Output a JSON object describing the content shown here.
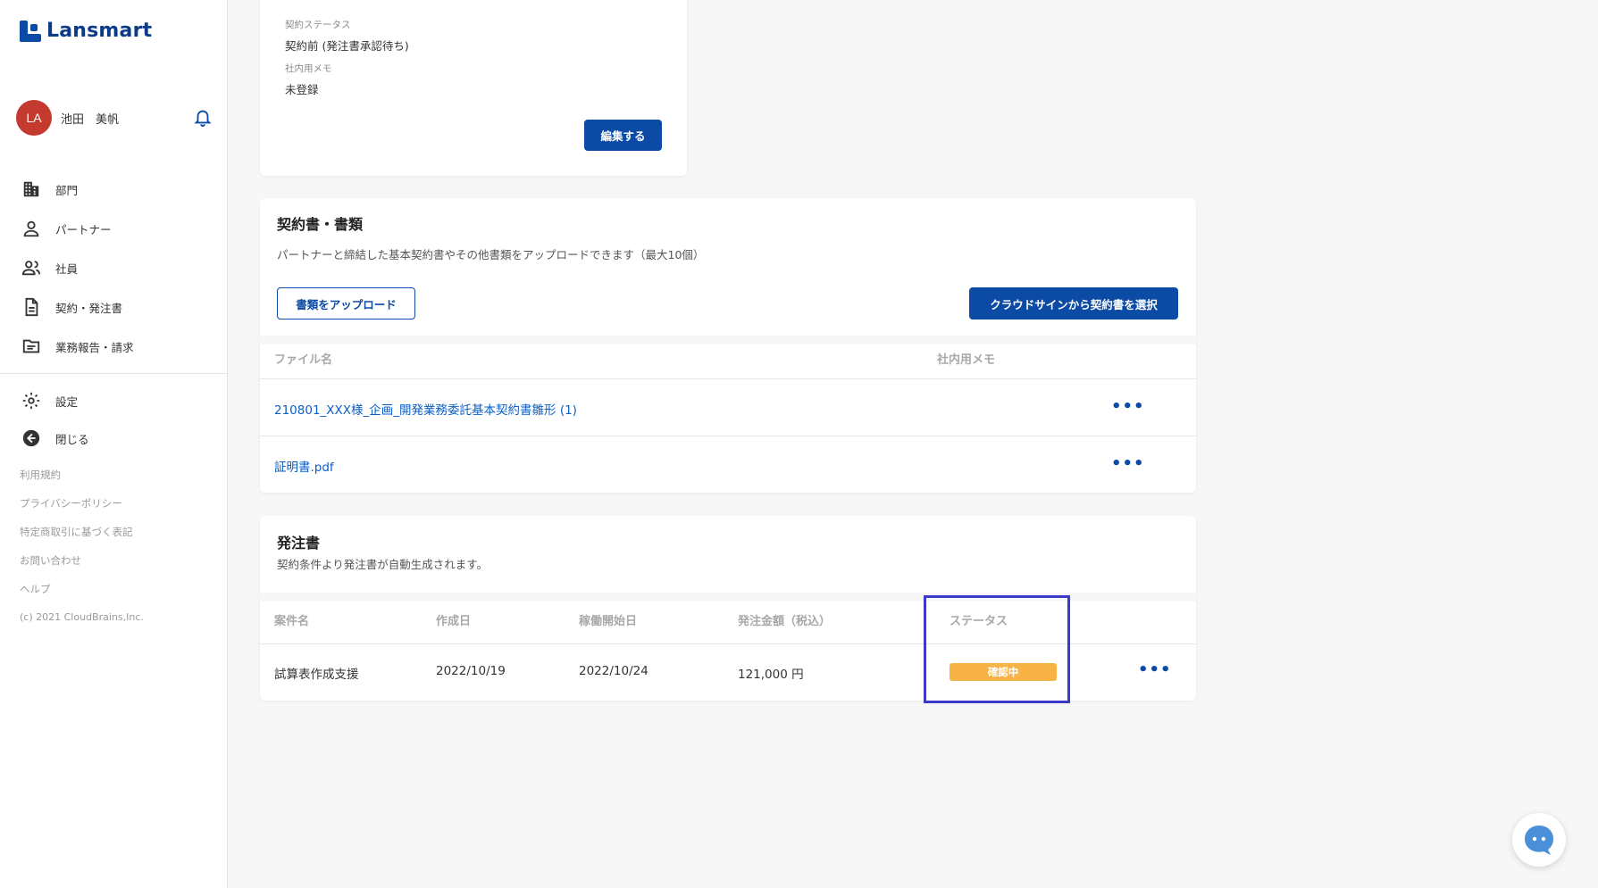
{
  "app": {
    "logo_text": "Lansmart"
  },
  "user": {
    "initials": "LA",
    "name": "池田　美帆"
  },
  "nav": {
    "items": [
      {
        "label": "部門",
        "icon": "building-icon"
      },
      {
        "label": "パートナー",
        "icon": "person-icon"
      },
      {
        "label": "社員",
        "icon": "people-icon"
      },
      {
        "label": "契約・発注書",
        "icon": "document-icon"
      },
      {
        "label": "業務報告・請求",
        "icon": "folder-icon"
      }
    ],
    "secondary": [
      {
        "label": "設定",
        "icon": "gear-icon"
      },
      {
        "label": "閉じる",
        "icon": "arrow-left-circle-icon"
      }
    ],
    "footer": [
      "利用規約",
      "プライバシーポリシー",
      "特定商取引に基づく表記",
      "お問い合わせ",
      "ヘルプ"
    ],
    "copyright": "(c) 2021 CloudBrains,Inc."
  },
  "contract_info": {
    "status_label": "契約ステータス",
    "status_value": "契約前 (発注書承認待ち)",
    "memo_label": "社内用メモ",
    "memo_value": "未登録",
    "edit_button": "編集する"
  },
  "documents": {
    "title": "契約書・書類",
    "description": "パートナーと締結した基本契約書やその他書類をアップロードできます（最大10個）",
    "upload_button": "書類をアップロード",
    "cloudsign_button": "クラウドサインから契約書を選択",
    "columns": {
      "file_name": "ファイル名",
      "memo": "社内用メモ"
    },
    "files": [
      {
        "name": "210801_XXX様_企画_開発業務委託基本契約書雛形 (1)",
        "memo": ""
      },
      {
        "name": "証明書.pdf",
        "memo": ""
      }
    ],
    "more_label": "•••"
  },
  "purchase_orders": {
    "title": "発注書",
    "description": "契約条件より発注書が自動生成されます。",
    "columns": {
      "project": "案件名",
      "created": "作成日",
      "start": "稼働開始日",
      "amount": "発注金額（税込）",
      "status": "ステータス"
    },
    "rows": [
      {
        "project": "試算表作成支援",
        "created": "2022/10/19",
        "start": "2022/10/24",
        "amount": "121,000 円",
        "status": "確認中"
      }
    ],
    "more_label": "•••"
  },
  "colors": {
    "primary": "#0b4aa5",
    "badge_pending": "#f7b346",
    "highlight": "#3a39c9",
    "avatar": "#c43a2e"
  }
}
